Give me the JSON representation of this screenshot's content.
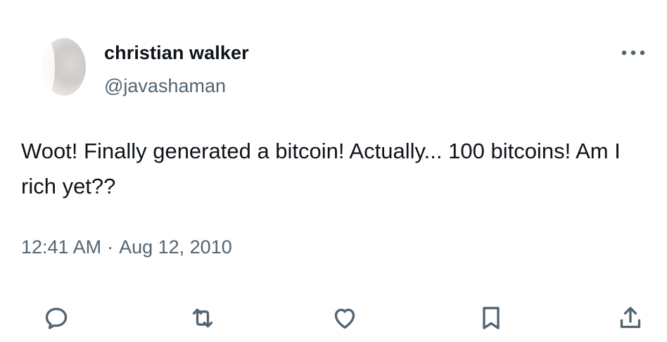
{
  "author": {
    "display_name": "christian walker",
    "handle": "@javashaman"
  },
  "tweet": {
    "text": "Woot! Finally generated a bitcoin! Actually... 100 bitcoins! Am I rich yet??",
    "time": "12:41 AM",
    "separator": "·",
    "date": "Aug 12, 2010"
  },
  "icons": {
    "more": "more-horizontal-icon",
    "reply": "reply-icon",
    "retweet": "retweet-icon",
    "like": "heart-icon",
    "bookmark": "bookmark-icon",
    "share": "share-icon"
  },
  "colors": {
    "text": "#0f1419",
    "secondary": "#536471"
  }
}
